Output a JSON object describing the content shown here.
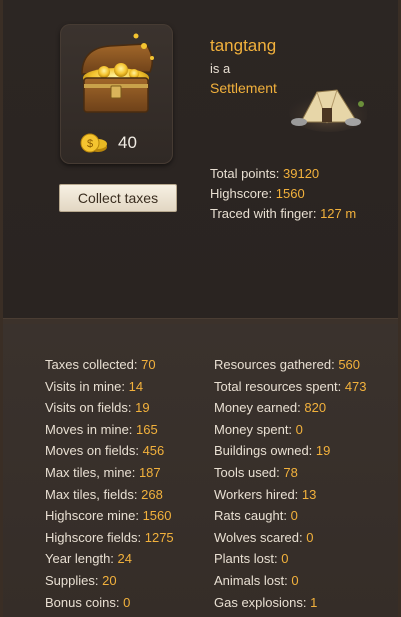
{
  "profile": {
    "name": "tangtang",
    "is_a": "is a",
    "rank": "Settlement",
    "coins": "40",
    "collect_label": "Collect taxes"
  },
  "totals": [
    {
      "label": "Total points:",
      "value": "39120"
    },
    {
      "label": "Highscore:",
      "value": "1560"
    },
    {
      "label": "Traced with finger:",
      "value": "127 m"
    }
  ],
  "stats_left": [
    {
      "label": "Taxes collected:",
      "value": "70"
    },
    {
      "label": "Visits in mine:",
      "value": "14"
    },
    {
      "label": "Visits on fields:",
      "value": "19"
    },
    {
      "label": "Moves in mine:",
      "value": "165"
    },
    {
      "label": "Moves on fields:",
      "value": "456"
    },
    {
      "label": "Max tiles, mine:",
      "value": "187"
    },
    {
      "label": "Max tiles, fields:",
      "value": "268"
    },
    {
      "label": "Highscore mine:",
      "value": "1560"
    },
    {
      "label": "Highscore fields:",
      "value": "1275"
    },
    {
      "label": "Year length:",
      "value": "24"
    },
    {
      "label": "Supplies:",
      "value": "20"
    },
    {
      "label": "Bonus coins:",
      "value": "0"
    }
  ],
  "stats_right": [
    {
      "label": "Resources gathered:",
      "value": "560"
    },
    {
      "label": "Total resources spent:",
      "value": "473"
    },
    {
      "label": "Money earned:",
      "value": "820"
    },
    {
      "label": "Money spent:",
      "value": "0"
    },
    {
      "label": "Buildings owned:",
      "value": "19"
    },
    {
      "label": "Tools used:",
      "value": "78"
    },
    {
      "label": "Workers hired:",
      "value": "13"
    },
    {
      "label": "Rats caught:",
      "value": "0"
    },
    {
      "label": "Wolves scared:",
      "value": "0"
    },
    {
      "label": "Plants lost:",
      "value": "0"
    },
    {
      "label": "Animals lost:",
      "value": "0"
    },
    {
      "label": "Gas explosions:",
      "value": "1"
    }
  ],
  "icons": {
    "chest": "treasure-chest-icon",
    "coin": "coin-stack-icon",
    "settlement": "tent-icon"
  },
  "colors": {
    "accent": "#f2b13c",
    "background": "#2a2421",
    "panel": "#362e29"
  }
}
